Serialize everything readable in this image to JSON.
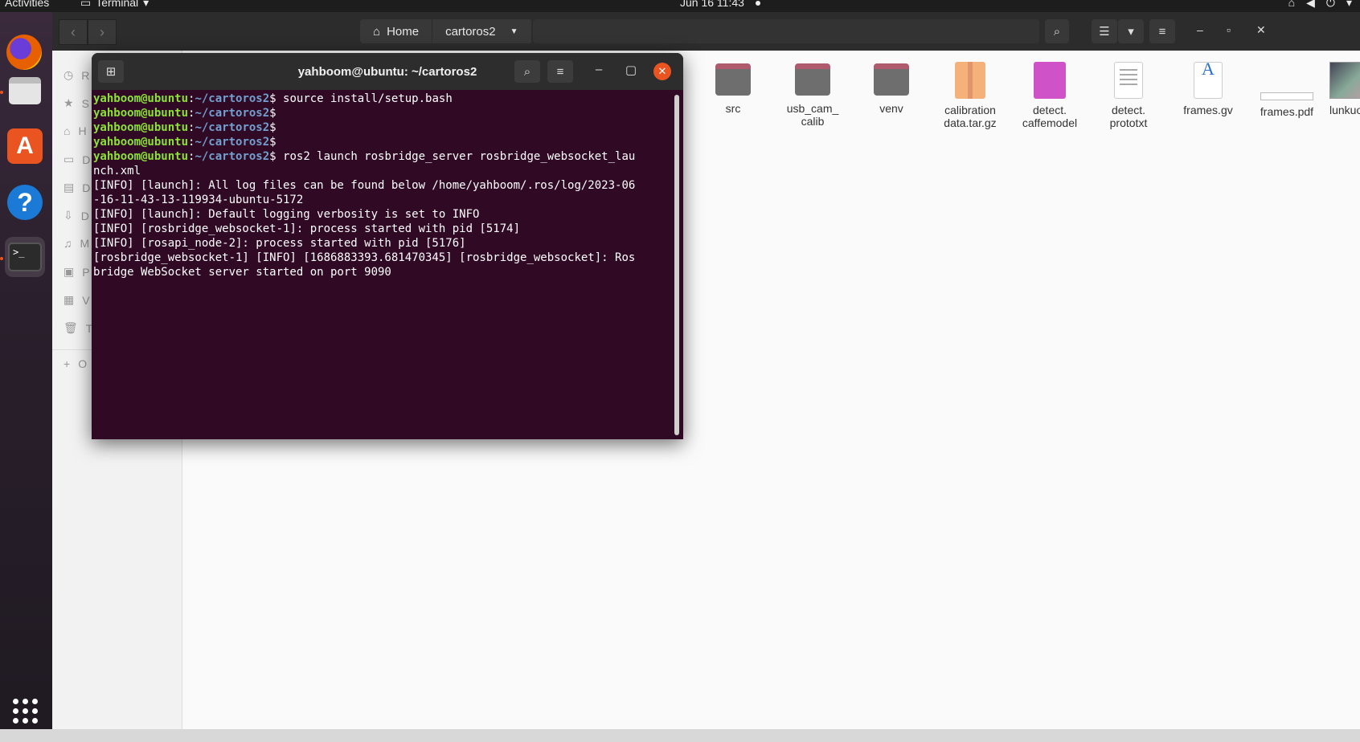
{
  "topbar": {
    "activities": "Activities",
    "app_name": "Terminal",
    "clock": "Jun 16  11:43"
  },
  "files": {
    "path": [
      "Home",
      "cartoros2"
    ],
    "sidebar_initials": [
      "R",
      "S",
      "H",
      "D",
      "D",
      "D",
      "M",
      "P",
      "V",
      "T"
    ],
    "other_label": "O",
    "items": [
      {
        "name": "src",
        "kind": "folder"
      },
      {
        "name": "usb_cam_\ncalib",
        "kind": "folder"
      },
      {
        "name": "venv",
        "kind": "folder"
      },
      {
        "name": "calibration\ndata.tar.gz",
        "kind": "archive"
      },
      {
        "name": "detect.\ncaffemodel",
        "kind": "image"
      },
      {
        "name": "detect.\nprototxt",
        "kind": "text"
      },
      {
        "name": "frames.gv",
        "kind": "gv"
      },
      {
        "name": "frames.pdf",
        "kind": "pdf"
      },
      {
        "name": "lunkuo.png",
        "kind": "photo"
      }
    ]
  },
  "terminal": {
    "title": "yahboom@ubuntu: ~/cartoros2",
    "user_host": "yahboom@ubuntu",
    "path": "~/cartoros2",
    "commands": [
      "source install/setup.bash",
      "",
      "",
      "",
      "ros2 launch rosbridge_server rosbridge_websocket_lau\nnch.xml"
    ],
    "output": [
      "[INFO] [launch]: All log files can be found below /home/yahboom/.ros/log/2023-06",
      "-16-11-43-13-119934-ubuntu-5172",
      "[INFO] [launch]: Default logging verbosity is set to INFO",
      "[INFO] [rosbridge_websocket-1]: process started with pid [5174]",
      "[INFO] [rosapi_node-2]: process started with pid [5176]",
      "[rosbridge_websocket-1] [INFO] [1686883393.681470345] [rosbridge_websocket]: Ros",
      "bridge WebSocket server started on port 9090"
    ]
  }
}
